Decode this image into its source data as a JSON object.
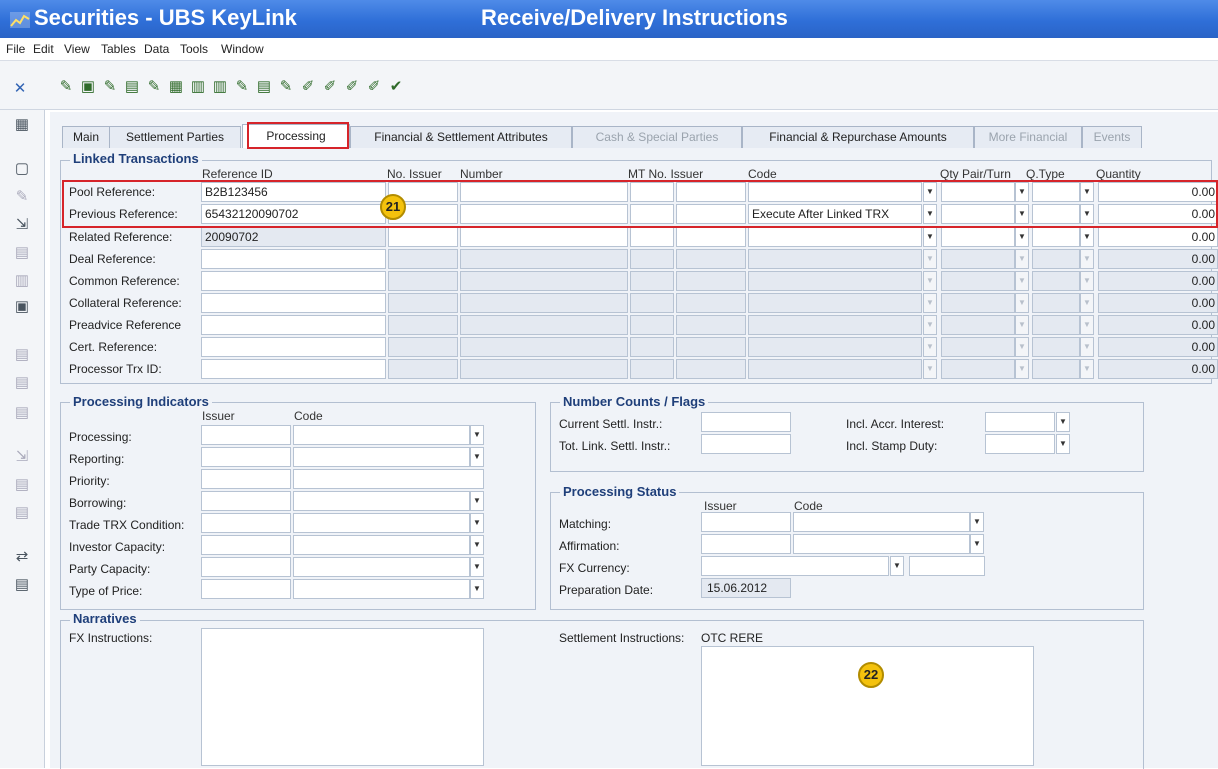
{
  "window": {
    "app_title": "Securities - UBS KeyLink",
    "screen_title": "Receive/Delivery Instructions"
  },
  "menu": [
    "File",
    "Edit",
    "View",
    "Tables",
    "Data",
    "Tools",
    "Window"
  ],
  "tabs": [
    "Main",
    "Settlement Parties",
    "Processing",
    "Financial & Settlement Attributes",
    "Cash & Special Parties",
    "Financial & Repurchase Amounts",
    "More Financial",
    "Events"
  ],
  "linked": {
    "title": "Linked Transactions",
    "headers": {
      "ref_id": "Reference ID",
      "no_issuer": "No. Issuer",
      "number": "Number",
      "mt_no_issuer": "MT No. Issuer",
      "code": "Code",
      "qty_pair": "Qty Pair/Turn",
      "qtype": "Q.Type",
      "quantity": "Quantity"
    },
    "rows": [
      {
        "label": "Pool Reference:",
        "ref": "B2B123456",
        "code": "",
        "qty": "0.00"
      },
      {
        "label": "Previous Reference:",
        "ref": "65432120090702",
        "code": "Execute After Linked TRX",
        "qty": "0.00"
      },
      {
        "label": "Related Reference:",
        "ref": "20090702",
        "code": "",
        "qty": "0.00"
      },
      {
        "label": "Deal Reference:",
        "ref": "",
        "code": "",
        "qty": "0.00"
      },
      {
        "label": "Common Reference:",
        "ref": "",
        "code": "",
        "qty": "0.00"
      },
      {
        "label": "Collateral Reference:",
        "ref": "",
        "code": "",
        "qty": "0.00"
      },
      {
        "label": "Preadvice Reference",
        "ref": "",
        "code": "",
        "qty": "0.00"
      },
      {
        "label": "Cert. Reference:",
        "ref": "",
        "code": "",
        "qty": "0.00"
      },
      {
        "label": "Processor Trx ID:",
        "ref": "",
        "code": "",
        "qty": "0.00"
      }
    ]
  },
  "processing_indicators": {
    "title": "Processing Indicators",
    "issuer_header": "Issuer",
    "code_header": "Code",
    "rows": [
      "Processing:",
      "Reporting:",
      "Priority:",
      "Borrowing:",
      "Trade TRX Condition:",
      "Investor Capacity:",
      "Party Capacity:",
      "Type of Price:"
    ]
  },
  "number_counts": {
    "title": "Number Counts / Flags",
    "current": "Current Settl. Instr.:",
    "total": "Tot. Link. Settl. Instr.:",
    "accr": "Incl. Accr. Interest:",
    "stamp": "Incl. Stamp Duty:"
  },
  "processing_status": {
    "title": "Processing Status",
    "issuer_header": "Issuer",
    "code_header": "Code",
    "matching": "Matching:",
    "affirmation": "Affirmation:",
    "fx_currency": "FX Currency:",
    "prep_label": "Preparation Date:",
    "prep_value": "15.06.2012"
  },
  "narratives": {
    "title": "Narratives",
    "fx_label": "FX Instructions:",
    "settl_label": "Settlement Instructions:",
    "settl_value": "OTC RERE"
  },
  "badges": {
    "b21": "21",
    "b22": "22"
  },
  "colors": {
    "title_bar": "#2f6fd8",
    "highlight": "#d6242a",
    "badge": "#f4c20d",
    "group_title": "#1f3f7a"
  }
}
